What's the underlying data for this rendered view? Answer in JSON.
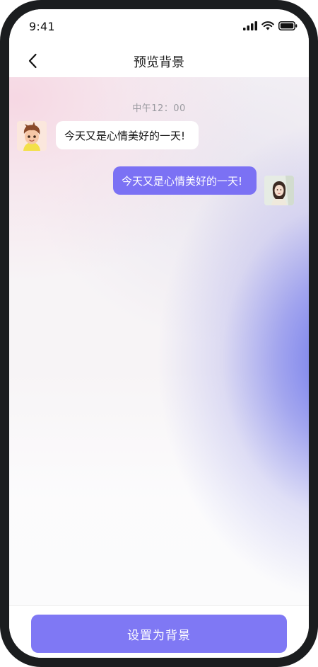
{
  "status_bar": {
    "time": "9:41",
    "icons": [
      "signal-icon",
      "wifi-icon",
      "battery-icon"
    ]
  },
  "nav": {
    "back_icon": "chevron-left-icon",
    "title": "预览背景"
  },
  "chat": {
    "timestamp": "中午12：00",
    "messages": [
      {
        "side": "left",
        "avatar": "boy-avatar",
        "text": "今天又是心情美好的一天!"
      },
      {
        "side": "right",
        "avatar": "girl-avatar",
        "text": "今天又是心情美好的一天!"
      }
    ]
  },
  "footer": {
    "set_background_label": "设置为背景"
  },
  "colors": {
    "accent": "#7b71f4",
    "button": "#7f78f4",
    "frame": "#1b1d1f"
  }
}
